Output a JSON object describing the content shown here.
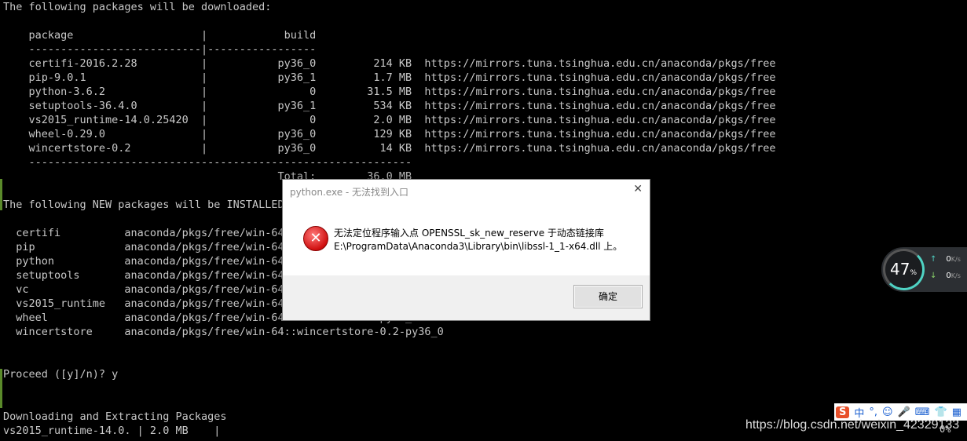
{
  "terminal": {
    "lines": [
      "The following packages will be downloaded:",
      "",
      "    package                    |            build",
      "    ---------------------------|-----------------",
      "    certifi-2016.2.28          |           py36_0         214 KB  https://mirrors.tuna.tsinghua.edu.cn/anaconda/pkgs/free",
      "    pip-9.0.1                  |           py36_1         1.7 MB  https://mirrors.tuna.tsinghua.edu.cn/anaconda/pkgs/free",
      "    python-3.6.2               |                0        31.5 MB  https://mirrors.tuna.tsinghua.edu.cn/anaconda/pkgs/free",
      "    setuptools-36.4.0          |           py36_1         534 KB  https://mirrors.tuna.tsinghua.edu.cn/anaconda/pkgs/free",
      "    vs2015_runtime-14.0.25420  |                0         2.0 MB  https://mirrors.tuna.tsinghua.edu.cn/anaconda/pkgs/free",
      "    wheel-0.29.0               |           py36_0         129 KB  https://mirrors.tuna.tsinghua.edu.cn/anaconda/pkgs/free",
      "    wincertstore-0.2           |           py36_0          14 KB  https://mirrors.tuna.tsinghua.edu.cn/anaconda/pkgs/free",
      "    ------------------------------------------------------------",
      "                                           Total:        36.0 MB",
      "",
      "The following NEW packages will be INSTALLED:",
      "",
      "  certifi          anaconda/pkgs/free/win-64::certifi-2016.2.28-py36_0",
      "  pip              anaconda/pkgs/free/win-64::pip-9.0.1-py36_1",
      "  python           anaconda/pkgs/free/win-64::python-3.6.2-0",
      "  setuptools       anaconda/pkgs/free/win-64::setuptools-36.4.0-py36_1",
      "  vc               anaconda/pkgs/free/win-64::vc-14-0",
      "  vs2015_runtime   anaconda/pkgs/free/win-64::vs2015_runtime-14.0.25420-0",
      "  wheel            anaconda/pkgs/free/win-64::wheel-0.29.0-py36_0",
      "  wincertstore     anaconda/pkgs/free/win-64::wincertstore-0.2-py36_0",
      "",
      "",
      "Proceed ([y]/n)? y",
      "",
      "",
      "Downloading and Extracting Packages",
      "vs2015_runtime-14.0. | 2.0 MB    |"
    ]
  },
  "dialog": {
    "title": "python.exe - 无法找到入口",
    "close_glyph": "✕",
    "icon": "error-icon",
    "icon_glyph": "✕",
    "message_line1": "无法定位程序输入点 OPENSSL_sk_new_reserve 于动态链接库",
    "message_line2": "E:\\ProgramData\\Anaconda3\\Library\\bin\\libssl-1_1-x64.dll 上。",
    "ok_label": "确定"
  },
  "monitor": {
    "percent": "47",
    "percent_unit": "%",
    "upload": "0",
    "download": "0",
    "unit": "K/s",
    "upload_arrow": "↑",
    "download_arrow": "↓"
  },
  "ime": {
    "logo": "S",
    "lang": "中",
    "punct": "°,",
    "emoji": "☺",
    "mic": "🎤",
    "keyboard": "⌨",
    "shirt": "👕",
    "grid": "▦"
  },
  "watermark": "https://blog.csdn.net/weixin_42329133",
  "tail_text": "0%"
}
